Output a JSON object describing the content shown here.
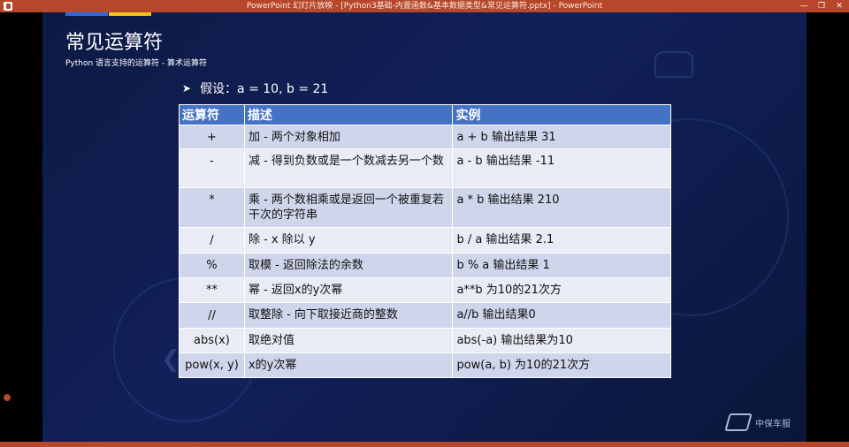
{
  "window": {
    "title": "PowerPoint 幻灯片放映 - [Python3基础-内置函数&基本数据类型&常见运算符.pptx] - PowerPoint"
  },
  "slide": {
    "title": "常见运算符",
    "subtitle": "Python 语言支持的运算符 - 算术运算符",
    "assumption": "假设：a = 10, b = 21"
  },
  "table": {
    "headers": [
      "运算符",
      "描述",
      "实例"
    ],
    "rows": [
      {
        "op": "+",
        "desc": "加 - 两个对象相加",
        "example": "a + b 输出结果 31"
      },
      {
        "op": "-",
        "desc": "减 - 得到负数或是一个数减去另一个数",
        "example": "a - b 输出结果 -11"
      },
      {
        "op": "*",
        "desc": "乘 - 两个数相乘或是返回一个被重复若干次的字符串",
        "example": "a * b 输出结果 210"
      },
      {
        "op": "/",
        "desc": "除 - x 除以 y",
        "example": "b / a 输出结果 2.1"
      },
      {
        "op": "%",
        "desc": "取模 - 返回除法的余数",
        "example": "b % a 输出结果 1"
      },
      {
        "op": "**",
        "desc": "幂 - 返回x的y次幂",
        "example": "a**b 为10的21次方"
      },
      {
        "op": "//",
        "desc": "取整除 - 向下取接近商的整数",
        "example": "a//b 输出结果0"
      },
      {
        "op": "abs(x)",
        "desc": "取绝对值",
        "example": "abs(-a) 输出结果为10"
      },
      {
        "op": "pow(x, y)",
        "desc": "x的y次幂",
        "example": "pow(a, b) 为10的21次方"
      }
    ]
  },
  "logo": {
    "text": "中保车服"
  },
  "colors": {
    "title_bar": "#b7472a",
    "header_fill": "#4472c4",
    "row_dark": "#cfd5ea",
    "row_light": "#e9ebf5",
    "slide_bg": "#12205a"
  }
}
